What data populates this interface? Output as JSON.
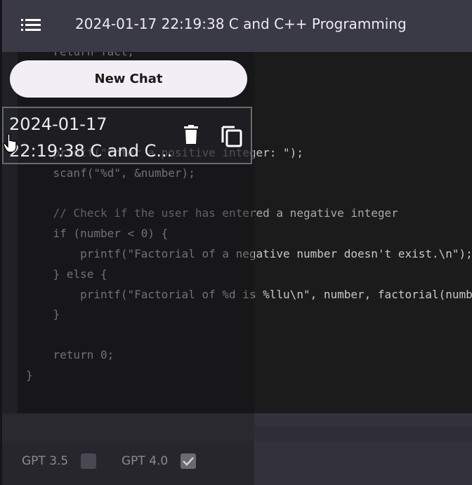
{
  "header": {
    "title": "2024-01-17 22:19:38 C and C++ Programming"
  },
  "sidebar": {
    "new_chat_label": "New Chat",
    "history": [
      {
        "line1": "2024-01-17",
        "line2": "22:19:38 C and C..."
      }
    ]
  },
  "code": {
    "lines": [
      "    return fact;",
      "}",
      "",
      "",
      "",
      "    printf(\"Enter a positive integer: \");",
      "    scanf(\"%d\", &number);",
      "",
      "    // Check if the user has entered a negative integer",
      "    if (number < 0) {",
      "        printf(\"Factorial of a negative number doesn't exist.\\n\");",
      "    } else {",
      "        printf(\"Factorial of %d is %llu\\n\", number, factorial(number));",
      "    }",
      "",
      "    return 0;",
      "}"
    ]
  },
  "models": [
    {
      "label": "GPT 3.5",
      "checked": false
    },
    {
      "label": "GPT 4.0",
      "checked": true
    }
  ],
  "colors": {
    "header_bg": "#3a3946",
    "code_bg": "#1b1b1b",
    "button_bg": "#f3eef6"
  }
}
